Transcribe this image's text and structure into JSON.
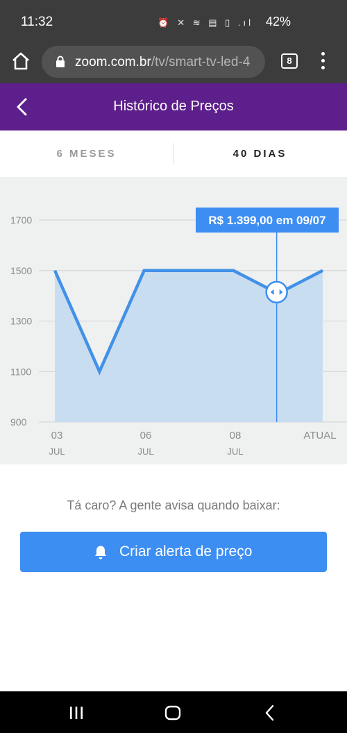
{
  "status_bar": {
    "time": "11:32",
    "system_icons": "⏰ 🔇 📶 Vo) 4G .ıl",
    "battery": "42%"
  },
  "browser": {
    "url_domain": "zoom.com.br",
    "url_path": "/tv/smart-tv-led-4",
    "tab_count": "8"
  },
  "header": {
    "title": "Histórico de Preços"
  },
  "period_tabs": [
    {
      "label": "6 MESES",
      "active": false
    },
    {
      "label": "40 DIAS",
      "active": true
    }
  ],
  "chart_data": {
    "type": "area",
    "y_ticks": [
      "1700",
      "1500",
      "1300",
      "1100",
      "900"
    ],
    "ylim": [
      900,
      1700
    ],
    "x_ticks": [
      {
        "day": "03",
        "month": "JUL"
      },
      {
        "day": "06",
        "month": "JUL"
      },
      {
        "day": "08",
        "month": "JUL"
      },
      {
        "day": "ATUAL",
        "month": ""
      }
    ],
    "series": [
      {
        "values": [
          1500,
          1100,
          1500,
          1500,
          1500,
          1409,
          1500
        ]
      }
    ],
    "selected_index": 5,
    "tooltip": "R$ 1.399,00 em 09/07",
    "colors": {
      "line": "#4291e8",
      "fill": "#c9ddf1",
      "tooltip": "#3d8ef2"
    }
  },
  "cta": {
    "hint": "Tá caro? A gente avisa quando baixar:",
    "button_label": "Criar alerta de preço"
  }
}
